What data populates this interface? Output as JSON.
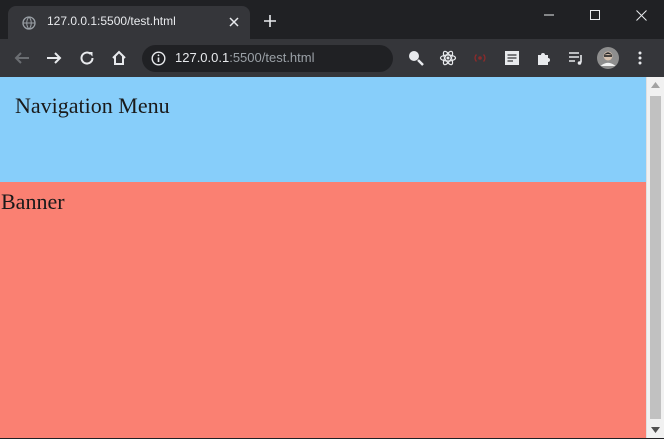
{
  "browser": {
    "tab": {
      "title": "127.0.0.1:5500/test.html",
      "close_label": "×"
    },
    "new_tab_label": "+",
    "window_controls": {
      "minimize": "—",
      "maximize": "☐",
      "close": "✕"
    },
    "address_bar": {
      "host": "127.0.0.1",
      "path": ":5500/test.html"
    },
    "toolbar_icons": [
      "back-icon",
      "forward-icon",
      "reload-icon",
      "home-icon",
      "zoom-icon",
      "bookmark-star-icon",
      "search-extension-icon",
      "react-devtools-icon",
      "broadcast-extension-icon",
      "notes-extension-icon",
      "extensions-puzzle-icon",
      "reading-list-icon",
      "profile-avatar",
      "menu-kebab-icon"
    ]
  },
  "page": {
    "nav_menu": {
      "text": "Navigation Menu",
      "color": "#87cefa"
    },
    "banner": {
      "text": "Banner",
      "color": "#fa8072"
    }
  }
}
